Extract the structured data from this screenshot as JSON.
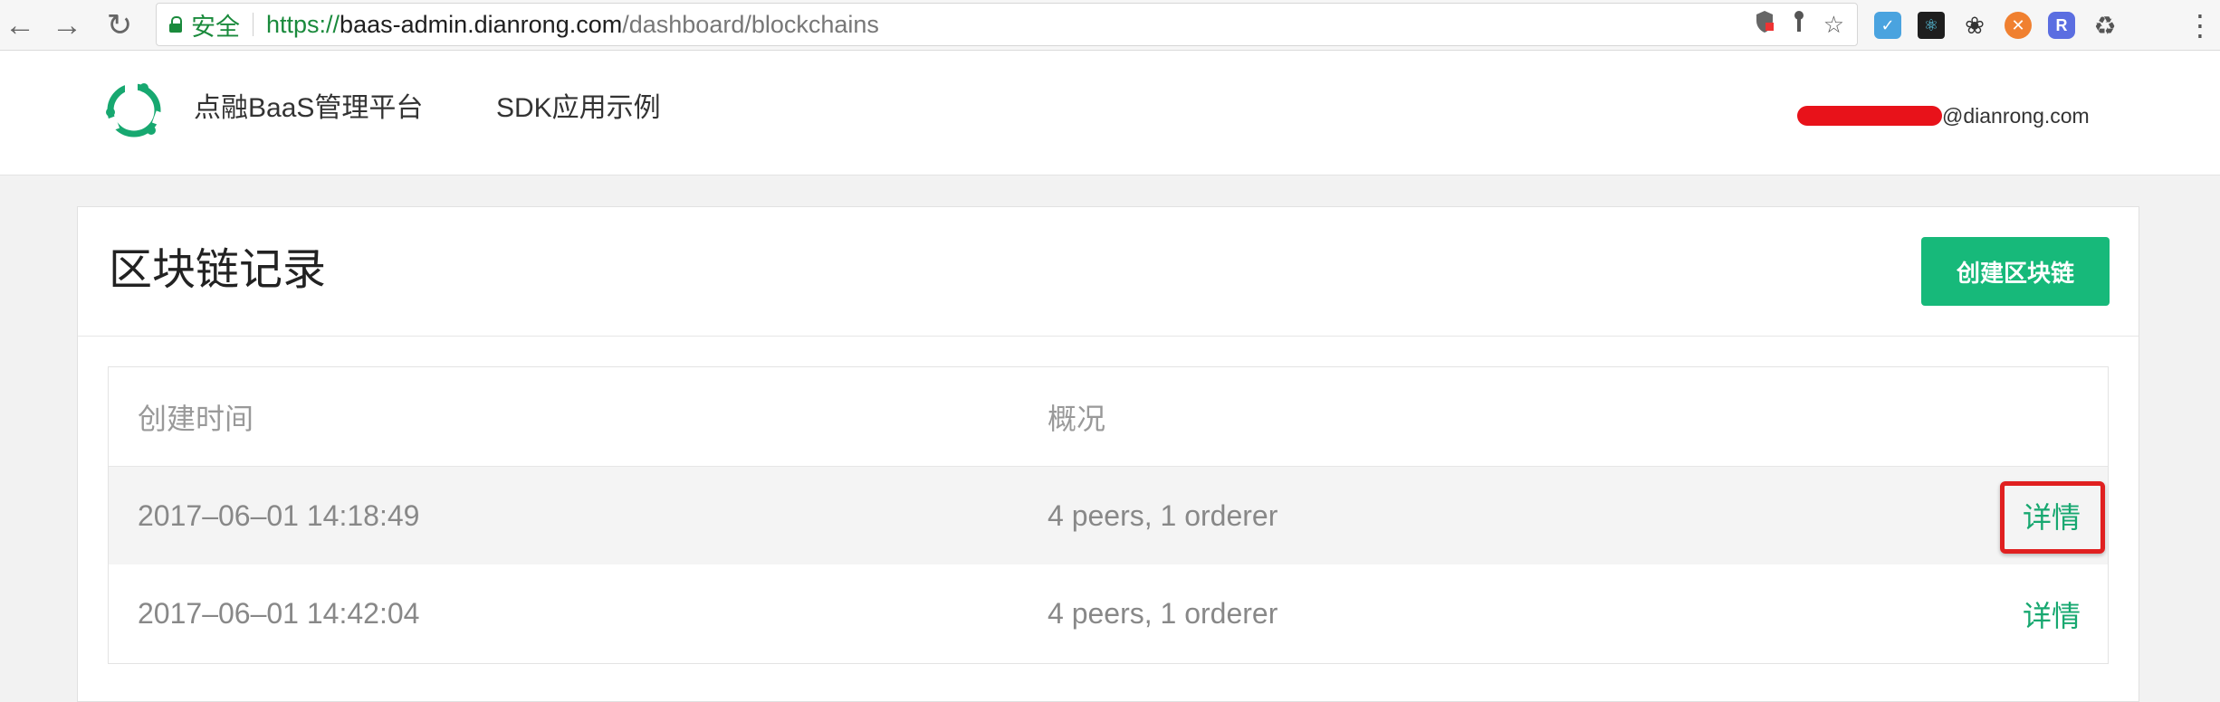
{
  "browser": {
    "secure_label": "安全",
    "url_scheme": "https://",
    "url_host": "baas-admin.dianrong.com",
    "url_path": "/dashboard/blockchains"
  },
  "header": {
    "brand": "点融BaaS管理平台",
    "nav_sdk": "SDK应用示例",
    "user_email_suffix": "@dianrong.com"
  },
  "card": {
    "title": "区块链记录",
    "create_button": "创建区块链"
  },
  "table": {
    "columns": [
      "创建时间",
      "概况"
    ],
    "rows": [
      {
        "created_at": "2017–06–01 14:18:49",
        "summary": "4 peers, 1 orderer",
        "action": "详情"
      },
      {
        "created_at": "2017–06–01 14:42:04",
        "summary": "4 peers, 1 orderer",
        "action": "详情"
      }
    ]
  },
  "colors": {
    "accent": "#17b97a",
    "link": "#17a870",
    "highlight": "#e02020",
    "secure": "#1a8a3c"
  },
  "icons": [
    "back-arrow-icon",
    "forward-arrow-icon",
    "reload-icon",
    "lock-icon",
    "star-icon",
    "menu-dots-icon",
    "app-logo-icon"
  ]
}
